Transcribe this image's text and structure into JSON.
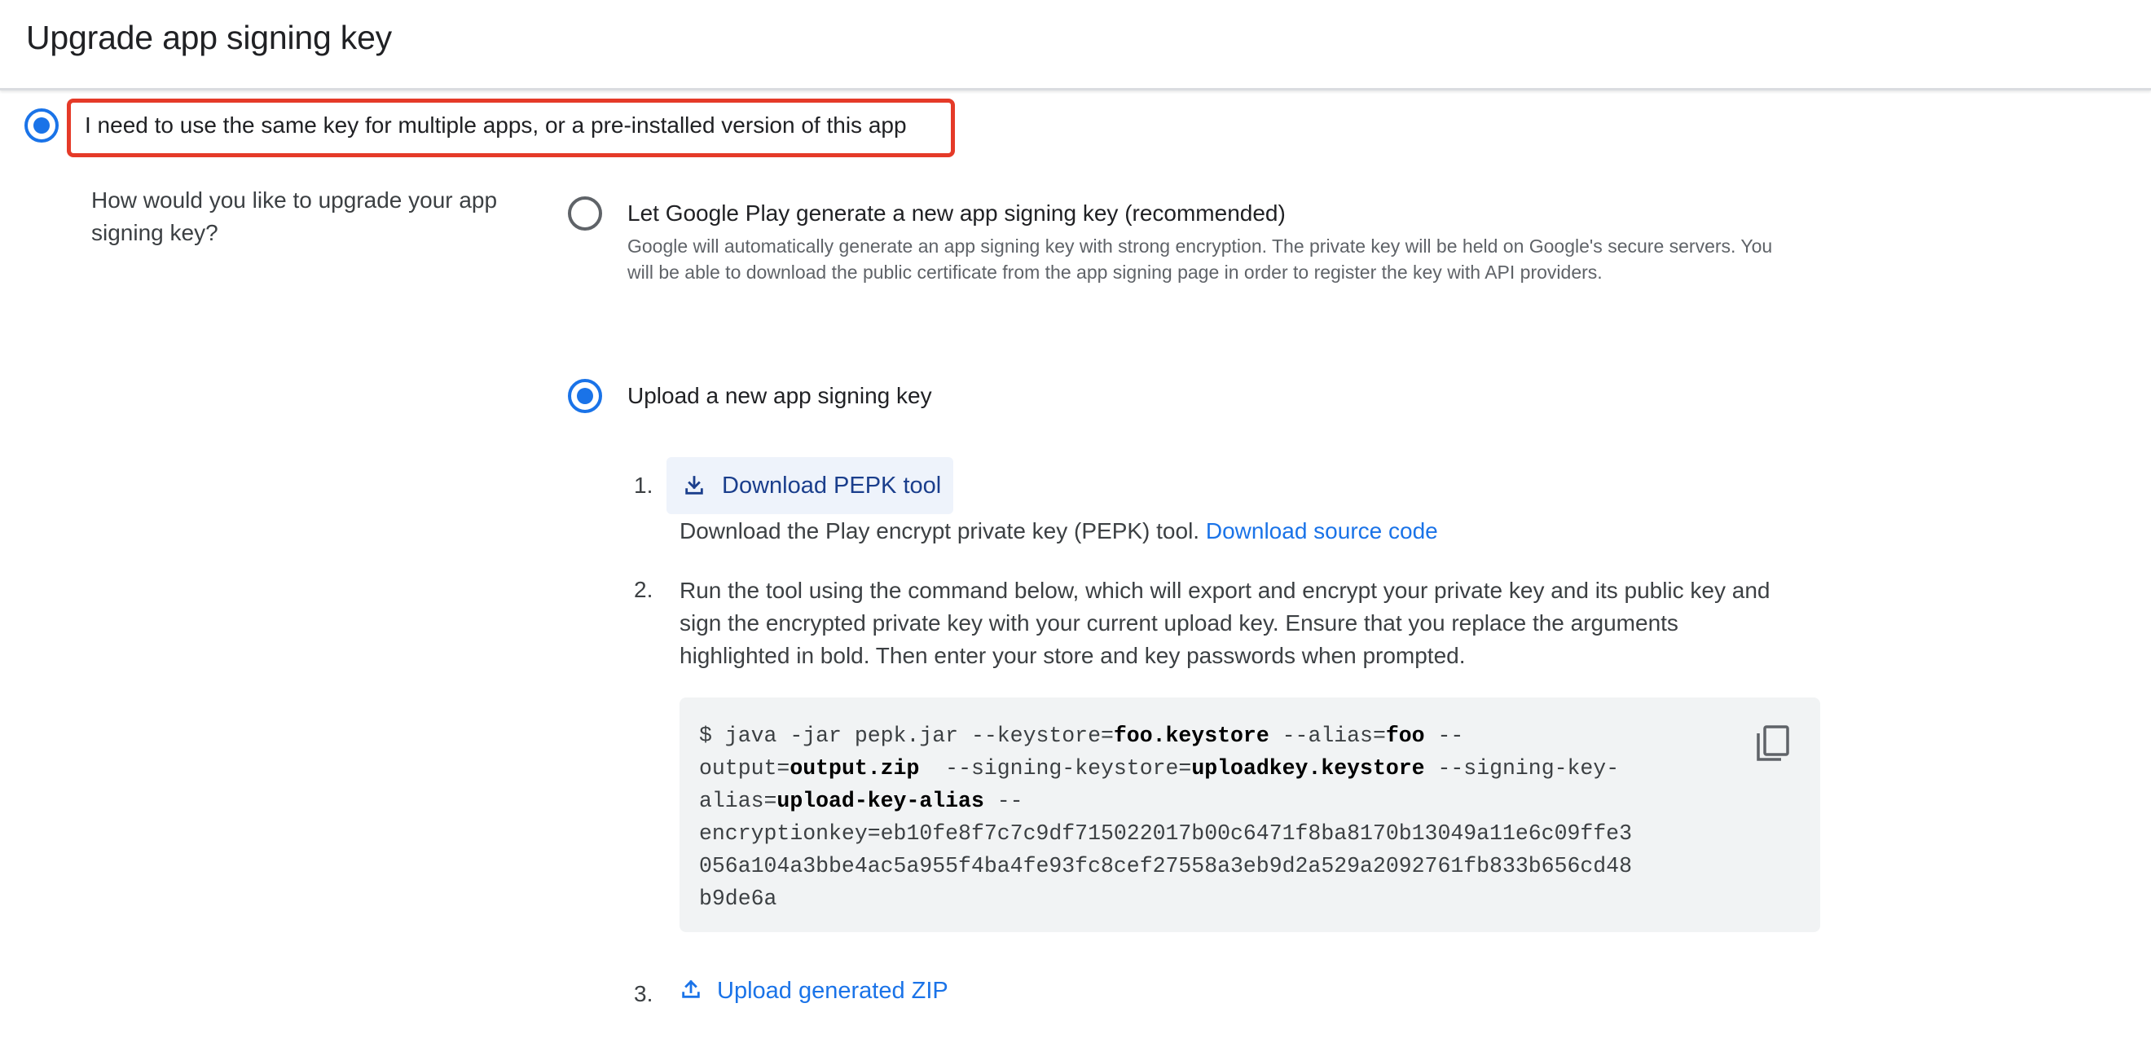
{
  "header": {
    "title": "Upgrade app signing key"
  },
  "top_option": {
    "label": "I need to use the same key for multiple apps, or a pre-installed version of this app",
    "checked": true
  },
  "upgrade": {
    "question": "How would you like to upgrade your app signing key?",
    "option_generate": {
      "label": "Let Google Play generate a new app signing key (recommended)",
      "description": "Google will automatically generate an app signing key with strong encryption. The private key will be held on Google's secure servers. You will be able to download the public certificate from the app signing page in order to register the key with API providers.",
      "checked": false
    },
    "option_upload": {
      "label": "Upload a new app signing key",
      "checked": true
    }
  },
  "steps": {
    "step1": {
      "number": "1.",
      "button_label": "Download PEPK tool",
      "icon": "download-icon",
      "text": "Download the Play encrypt private key (PEPK) tool.",
      "link": "Download source code"
    },
    "step2": {
      "number": "2.",
      "lines": [
        "Run the tool using the command below, which will export and encrypt your private key and its public key and",
        "sign the encrypted private key with your current upload key. Ensure that you replace the arguments",
        "highlighted in bold. Then enter your store and key passwords when prompted."
      ],
      "code": {
        "l1_a": "$ java -jar pepk.jar --keystore=",
        "l1_b": "foo.keystore",
        "l1_c": " --alias=",
        "l1_d": "foo",
        "l1_e": " --",
        "l2_a": "output=",
        "l2_b": "output.zip",
        "l2_c": "  --signing-keystore=",
        "l2_d": "uploadkey.keystore",
        "l2_e": " --signing-key-",
        "l3_a": "alias=",
        "l3_b": "upload-key-alias",
        "l3_c": " --",
        "l4": "encryptionkey=eb10fe8f7c7c9df715022017b00c6471f8ba8170b13049a11e6c09ffe3",
        "l5": "056a104a3bbe4ac5a955f4ba4fe93fc8cef27558a3eb9d2a529a2092761fb833b656cd48",
        "l6": "b9de6a"
      },
      "copy_icon": "copy-icon"
    },
    "step3": {
      "number": "3.",
      "button_label": "Upload generated ZIP",
      "icon": "upload-icon"
    }
  },
  "colors": {
    "accent": "#1a73e8",
    "highlight_border": "#e53a28",
    "code_bg": "#f1f3f4"
  }
}
